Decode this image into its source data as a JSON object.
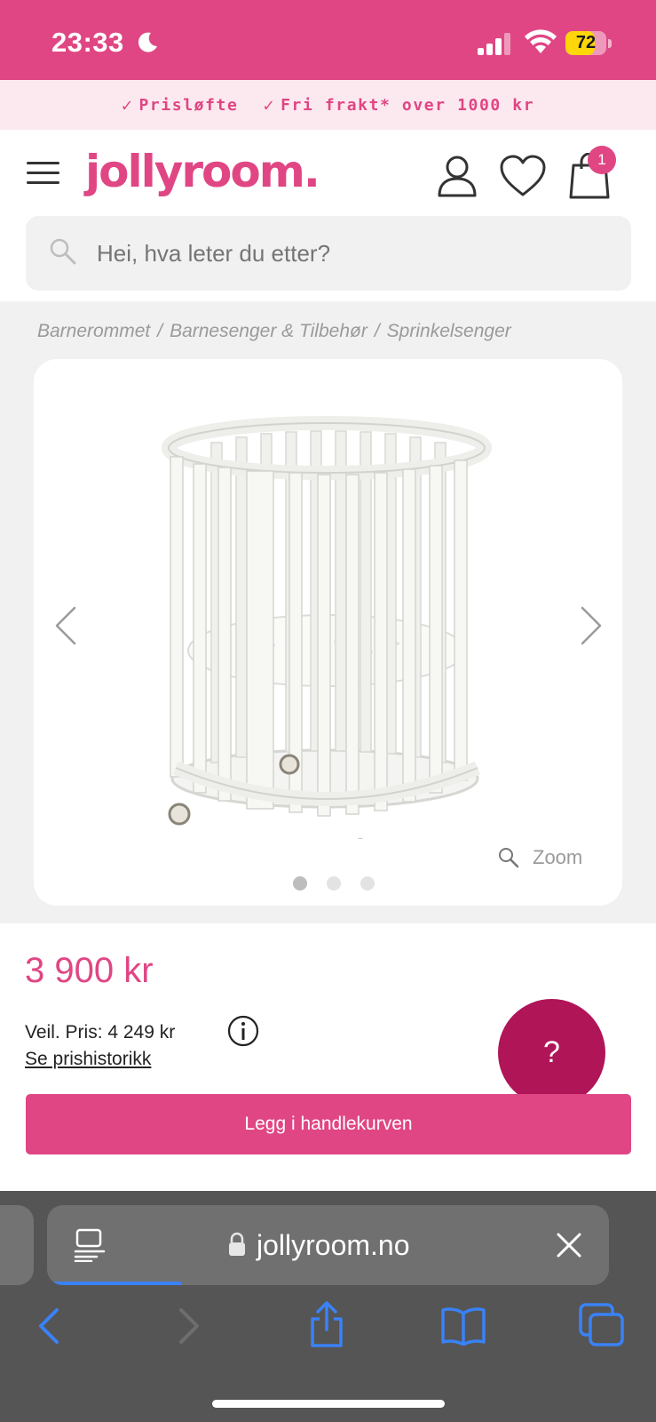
{
  "status_bar": {
    "time": "23:33",
    "battery_level": "72",
    "battery_fraction": 0.72,
    "icons": [
      "moon-icon",
      "signal-icon",
      "wifi-icon",
      "battery-icon"
    ]
  },
  "usp": {
    "items": [
      "Prisløfte",
      "Fri frakt* over 1000 kr"
    ]
  },
  "header": {
    "logo": "jollyroom.",
    "cart_count": "1",
    "icons": [
      "menu-icon",
      "user-icon",
      "heart-icon",
      "shopping-bag-icon"
    ]
  },
  "search": {
    "placeholder": "Hei, hva leter du etter?"
  },
  "breadcrumb": {
    "items": [
      "Barnerommet",
      "Barnesenger & Tilbehør",
      "Sprinkelsenger"
    ],
    "separator": "/"
  },
  "gallery": {
    "zoom_label": "Zoom",
    "image_count": 3,
    "active_index": 0
  },
  "product": {
    "price": "3 900 kr",
    "recommended_price": "Veil. Pris: 4 249 kr",
    "price_history_link": "Se prishistorikk",
    "add_to_cart": "Legg i handlekurven",
    "help_label": "?"
  },
  "browser": {
    "url": "jollyroom.no",
    "load_progress": 0.24
  },
  "colors": {
    "brand": "#e04684",
    "brand_dark": "#b01558",
    "usp_background": "#fce9ef",
    "browser_chrome": "#555555"
  }
}
